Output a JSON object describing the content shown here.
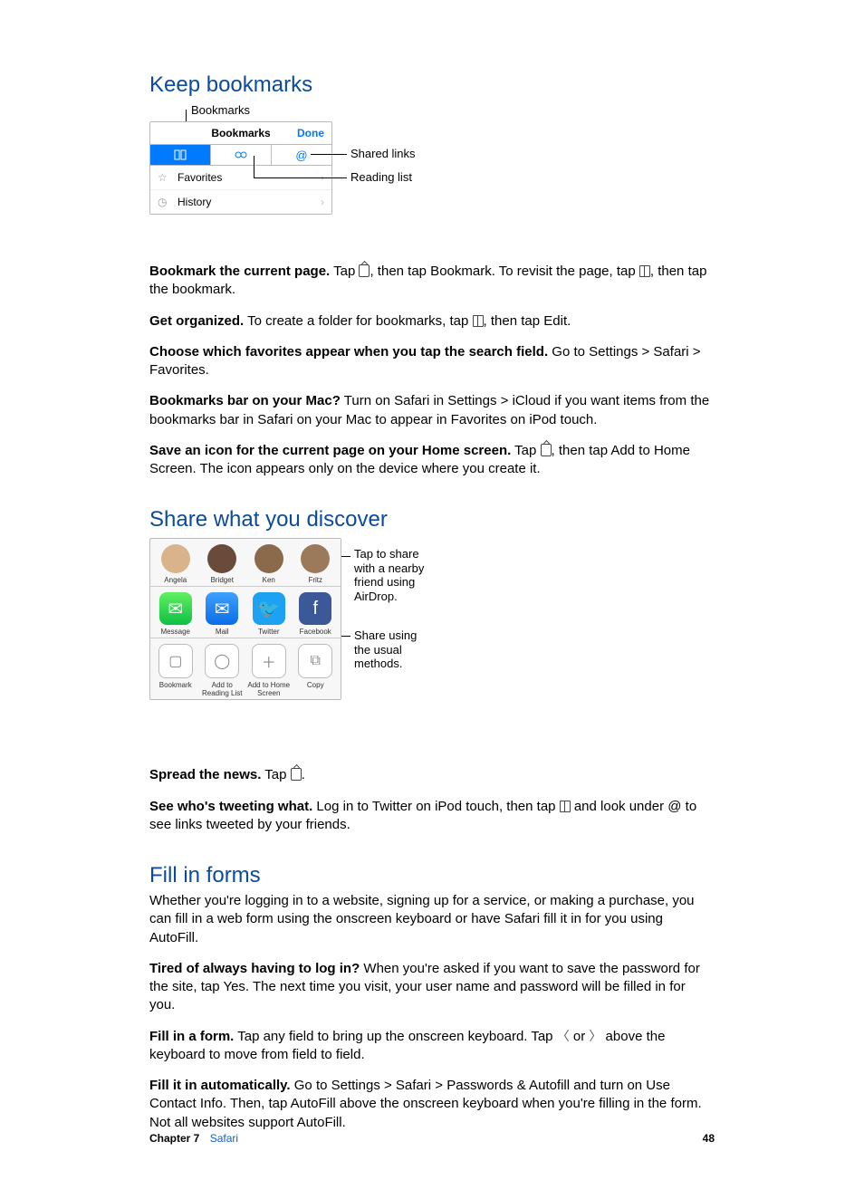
{
  "headings": {
    "h1": "Keep bookmarks",
    "h2": "Share what you discover",
    "h3": "Fill in forms"
  },
  "bookmarks_panel": {
    "callout_top": "Bookmarks",
    "title": "Bookmarks",
    "done": "Done",
    "callout_shared": "Shared links",
    "callout_reading": "Reading list",
    "row_fav": "Favorites",
    "row_history": "History"
  },
  "share_panel": {
    "callout1": "Tap to share with a nearby friend using AirDrop.",
    "callout2": "Share using the usual methods.",
    "people": [
      "Angela",
      "Bridget",
      "Ken",
      "Fritz"
    ],
    "apps": [
      "Message",
      "Mail",
      "Twitter",
      "Facebook"
    ],
    "actions": [
      "Bookmark",
      "Add to Reading List",
      "Add to Home Screen",
      "Copy"
    ]
  },
  "paragraphs": {
    "p1b": "Bookmark the current page.",
    "p1a": " Tap ",
    "p1c": ", then tap Bookmark. To revisit the page, tap ",
    "p1d": ", then tap the bookmark.",
    "p2b": "Get organized.",
    "p2a": " To create a folder for bookmarks, tap ",
    "p2c": ", then tap Edit.",
    "p3b": "Choose which favorites appear when you tap the search field.",
    "p3a": " Go to Settings > Safari > Favorites.",
    "p4b": "Bookmarks bar on your Mac?",
    "p4a": " Turn on Safari in Settings > iCloud if you want items from the bookmarks bar in Safari on your Mac to appear in Favorites on iPod touch.",
    "p5b": "Save an icon for the current page on your Home screen.",
    "p5a": " Tap ",
    "p5c": ", then tap Add to Home Screen. The icon appears only on the device where you create it.",
    "p6b": "Spread the news.",
    "p6a": " Tap ",
    "p6c": ".",
    "p7b": "See who's tweeting what.",
    "p7a": " Log in to Twitter on iPod touch, then tap ",
    "p7c": " and look under ",
    "p7d": " to see links tweeted by your friends.",
    "p8": "Whether you're logging in to a website, signing up for a service, or making a purchase, you can fill in a web form using the onscreen keyboard or have Safari fill it in for you using AutoFill.",
    "p9b": "Tired of always having to log in?",
    "p9a": " When you're asked if you want to save the password for the site, tap Yes. The next time you visit, your user name and password will be filled in for you.",
    "p10b": "Fill in a form.",
    "p10a": " Tap any field to bring up the onscreen keyboard. Tap ",
    "p10c": " or ",
    "p10d": " above the keyboard to move from field to field.",
    "p11b": "Fill it in automatically.",
    "p11a": " Go to Settings > Safari > Passwords & Autofill and turn on Use Contact Info. Then, tap AutoFill above the onscreen keyboard when you're filling in the form. Not all websites support AutoFill."
  },
  "footer": {
    "chapter_label": "Chapter  7",
    "chapter_name": "Safari",
    "page": "48"
  }
}
